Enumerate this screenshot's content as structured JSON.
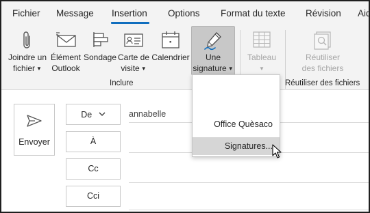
{
  "tabs": [
    {
      "label": "Fichier"
    },
    {
      "label": "Message"
    },
    {
      "label": "Insertion",
      "active": true
    },
    {
      "label": "Options"
    },
    {
      "label": "Format du texte"
    },
    {
      "label": "Révision"
    },
    {
      "label": "Aid"
    }
  ],
  "ribbon": {
    "buttons": [
      {
        "line1": "Joindre un",
        "line2": "fichier",
        "dropdown": true,
        "icon": "paperclip-icon"
      },
      {
        "line1": "Élément",
        "line2": "Outlook",
        "dropdown": false,
        "icon": "envelope-icon"
      },
      {
        "line1": "Sondage",
        "line2": "",
        "dropdown": false,
        "icon": "poll-icon"
      },
      {
        "line1": "Carte de",
        "line2": "visite",
        "dropdown": true,
        "icon": "business-card-icon"
      },
      {
        "line1": "Calendrier",
        "line2": "",
        "dropdown": false,
        "icon": "calendar-icon"
      },
      {
        "line1": "Une",
        "line2": "signature",
        "dropdown": true,
        "icon": "signature-pen-icon",
        "pressed": true
      },
      {
        "line1": "Tableau",
        "line2": "",
        "dropdown": true,
        "icon": "table-icon",
        "disabled": true
      },
      {
        "line1": "Réutiliser",
        "line2": "des fichiers",
        "dropdown": false,
        "icon": "reuse-files-icon",
        "disabled": true
      }
    ],
    "groups": {
      "include": "Inclure",
      "reuse": "Réutiliser des fichiers"
    }
  },
  "compose": {
    "send_label": "Envoyer",
    "from_label": "De",
    "from_value": "annabelle",
    "to_label": "À",
    "cc_label": "Cc",
    "bcc_label": "Cci"
  },
  "signature_menu": {
    "items": [
      "Office Quèsaco",
      "Signatures..."
    ]
  },
  "colors": {
    "accent": "#106ebe",
    "ribbon_bg": "#f3f3f3",
    "pressed_bg": "#c8c8c8",
    "disabled_text": "#a6a6a6"
  }
}
